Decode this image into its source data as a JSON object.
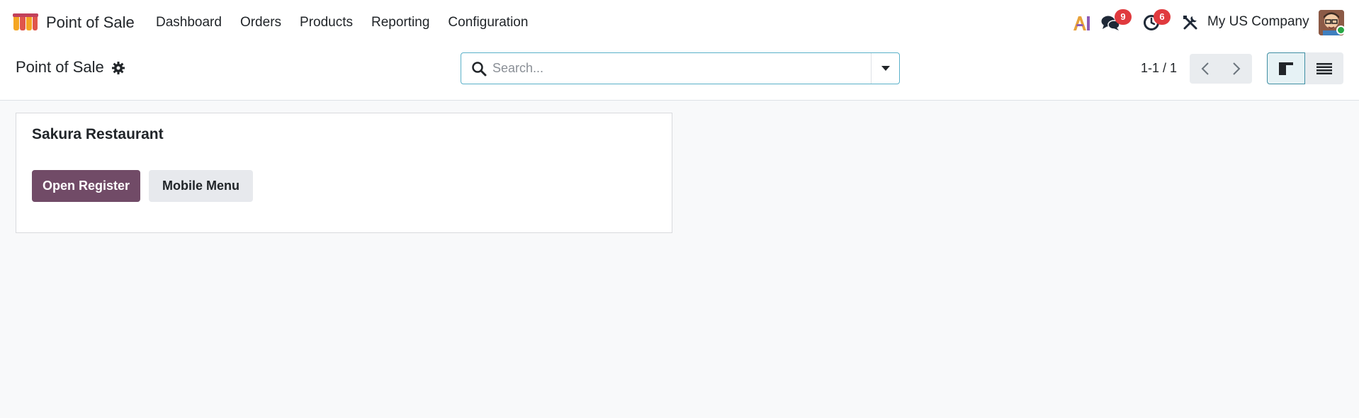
{
  "navbar": {
    "app_name": "Point of Sale",
    "menu": [
      {
        "label": "Dashboard"
      },
      {
        "label": "Orders"
      },
      {
        "label": "Products"
      },
      {
        "label": "Reporting"
      },
      {
        "label": "Configuration"
      }
    ],
    "systray": {
      "ai_icon": "ai-icon",
      "messages_count": "9",
      "activities_count": "6",
      "company_name": "My US Company"
    }
  },
  "control_panel": {
    "title": "Point of Sale",
    "search": {
      "placeholder": "Search..."
    },
    "pager": "1-1 / 1"
  },
  "card": {
    "title": "Sakura Restaurant",
    "primary_button": "Open Register",
    "secondary_button": "Mobile Menu"
  },
  "colors": {
    "brand": "#714b67",
    "badge": "#e03a3e",
    "search_border": "#5ab0c9"
  }
}
